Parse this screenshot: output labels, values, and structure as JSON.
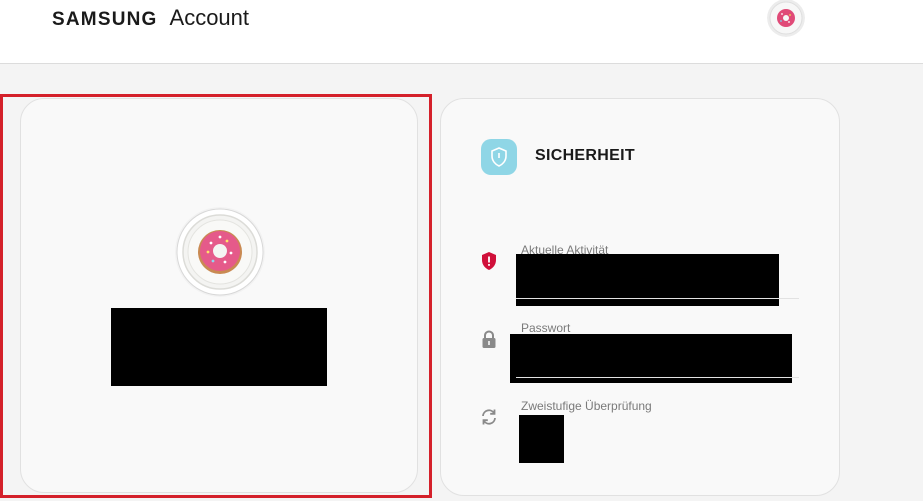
{
  "header": {
    "brand_samsung": "SAMSUNG",
    "brand_account": "Account",
    "avatar_icon": "donut-avatar-icon"
  },
  "profile": {
    "avatar_icon": "donut-avatar-icon",
    "name_redacted": true
  },
  "security": {
    "badge_icon": "shield-icon",
    "title": "SICHERHEIT",
    "items": [
      {
        "label": "Aktuelle Aktivität",
        "icon": "alert-shield-icon",
        "value_redacted": true
      },
      {
        "label": "Passwort",
        "icon": "lock-icon",
        "value_redacted": true
      },
      {
        "label": "Zweistufige Überprüfung",
        "icon": "sync-icon",
        "value_redacted": true
      }
    ]
  },
  "colors": {
    "highlight_border": "#d4202a",
    "badge_bg": "#8fd6e6",
    "alert_red": "#d0103a",
    "lock_gray": "#8a8a8a"
  }
}
